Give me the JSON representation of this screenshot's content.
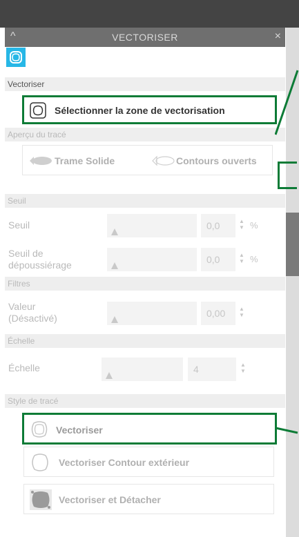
{
  "window": {
    "title": "VECTORISER",
    "close": "×",
    "collapse": "^"
  },
  "sections": {
    "vectoriser": "Vectoriser",
    "apercu": "Aperçu du tracé",
    "seuil": "Seuil",
    "filtres": "Filtres",
    "echelle": "Échelle",
    "style": "Style de tracé"
  },
  "select_area_button": "Sélectionner la zone de vectorisation",
  "preview": {
    "solid": "Trame Solide",
    "open": "Contours ouverts"
  },
  "seuil": {
    "threshold_label": "Seuil",
    "threshold_value": "0,0",
    "threshold_unit": "%",
    "dust_label_1": "Seuil de",
    "dust_label_2": "dépoussiérage",
    "dust_value": "0,0",
    "dust_unit": "%"
  },
  "filtres": {
    "label_1": "Valeur",
    "label_2": "(Désactivé)",
    "value": "0,00"
  },
  "echelle": {
    "label": "Échelle",
    "value": "4"
  },
  "style": {
    "vectoriser": "Vectoriser",
    "outline": "Vectoriser Contour extérieur",
    "detach": "Vectoriser et Détacher"
  },
  "colors": {
    "accent": "#27b7e6",
    "highlight": "#0c7b36",
    "titlebar": "#6f6f6f"
  }
}
